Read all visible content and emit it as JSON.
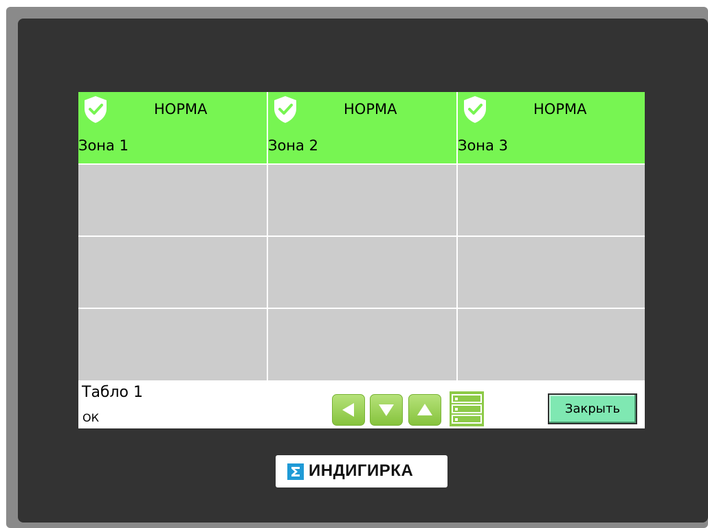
{
  "zones": [
    {
      "name": "Зона 1",
      "status": "НОРМА"
    },
    {
      "name": "Зона 2",
      "status": "НОРМА"
    },
    {
      "name": "Зона 3",
      "status": "НОРМА"
    }
  ],
  "footer": {
    "title": "Табло 1",
    "status": "ОК",
    "close_label": "Закрыть"
  },
  "icons": {
    "zone_status": "shield-check-icon",
    "nav_left": "arrow-left-icon",
    "nav_down": "arrow-down-icon",
    "nav_up": "arrow-up-icon",
    "list": "list-icon"
  },
  "colors": {
    "zone_ok": "#77f552",
    "empty_cell": "#cccccc",
    "bezel": "#333333",
    "button_green": "#8dca48",
    "close_button": "#7fe8b2",
    "logo_accent": "#1f9ad6"
  },
  "logo": {
    "text": "ИНДИГИРКА"
  }
}
